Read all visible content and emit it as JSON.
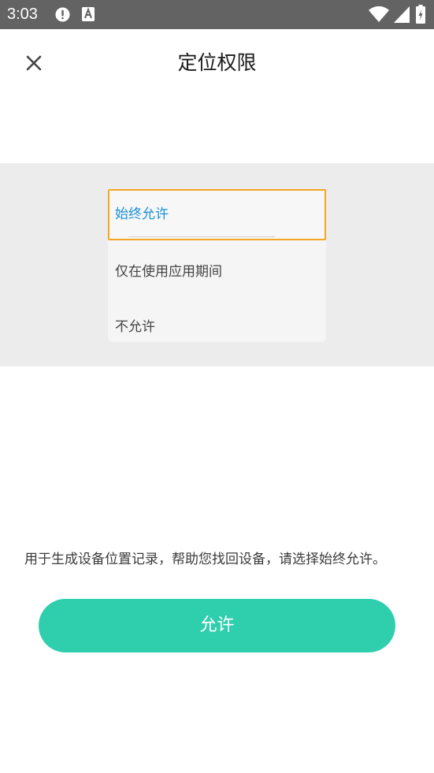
{
  "status_bar": {
    "time": "3:03",
    "icons": [
      "alert-icon",
      "font-icon",
      "wifi-icon",
      "signal-icon",
      "battery-icon"
    ]
  },
  "header": {
    "title": "定位权限",
    "close_icon": "close-icon"
  },
  "permission_options": {
    "selected": "始终允许",
    "items": [
      {
        "label": "始终允许"
      },
      {
        "label": "仅在使用应用期间"
      },
      {
        "label": "不允许"
      }
    ],
    "highlight_color": "#f5a623",
    "selected_text_color": "#1a8fd8"
  },
  "description": "用于生成设备位置记录，帮助您找回设备，请选择始终允许。",
  "allow_button": {
    "label": "允许",
    "color": "#2fcfae"
  }
}
